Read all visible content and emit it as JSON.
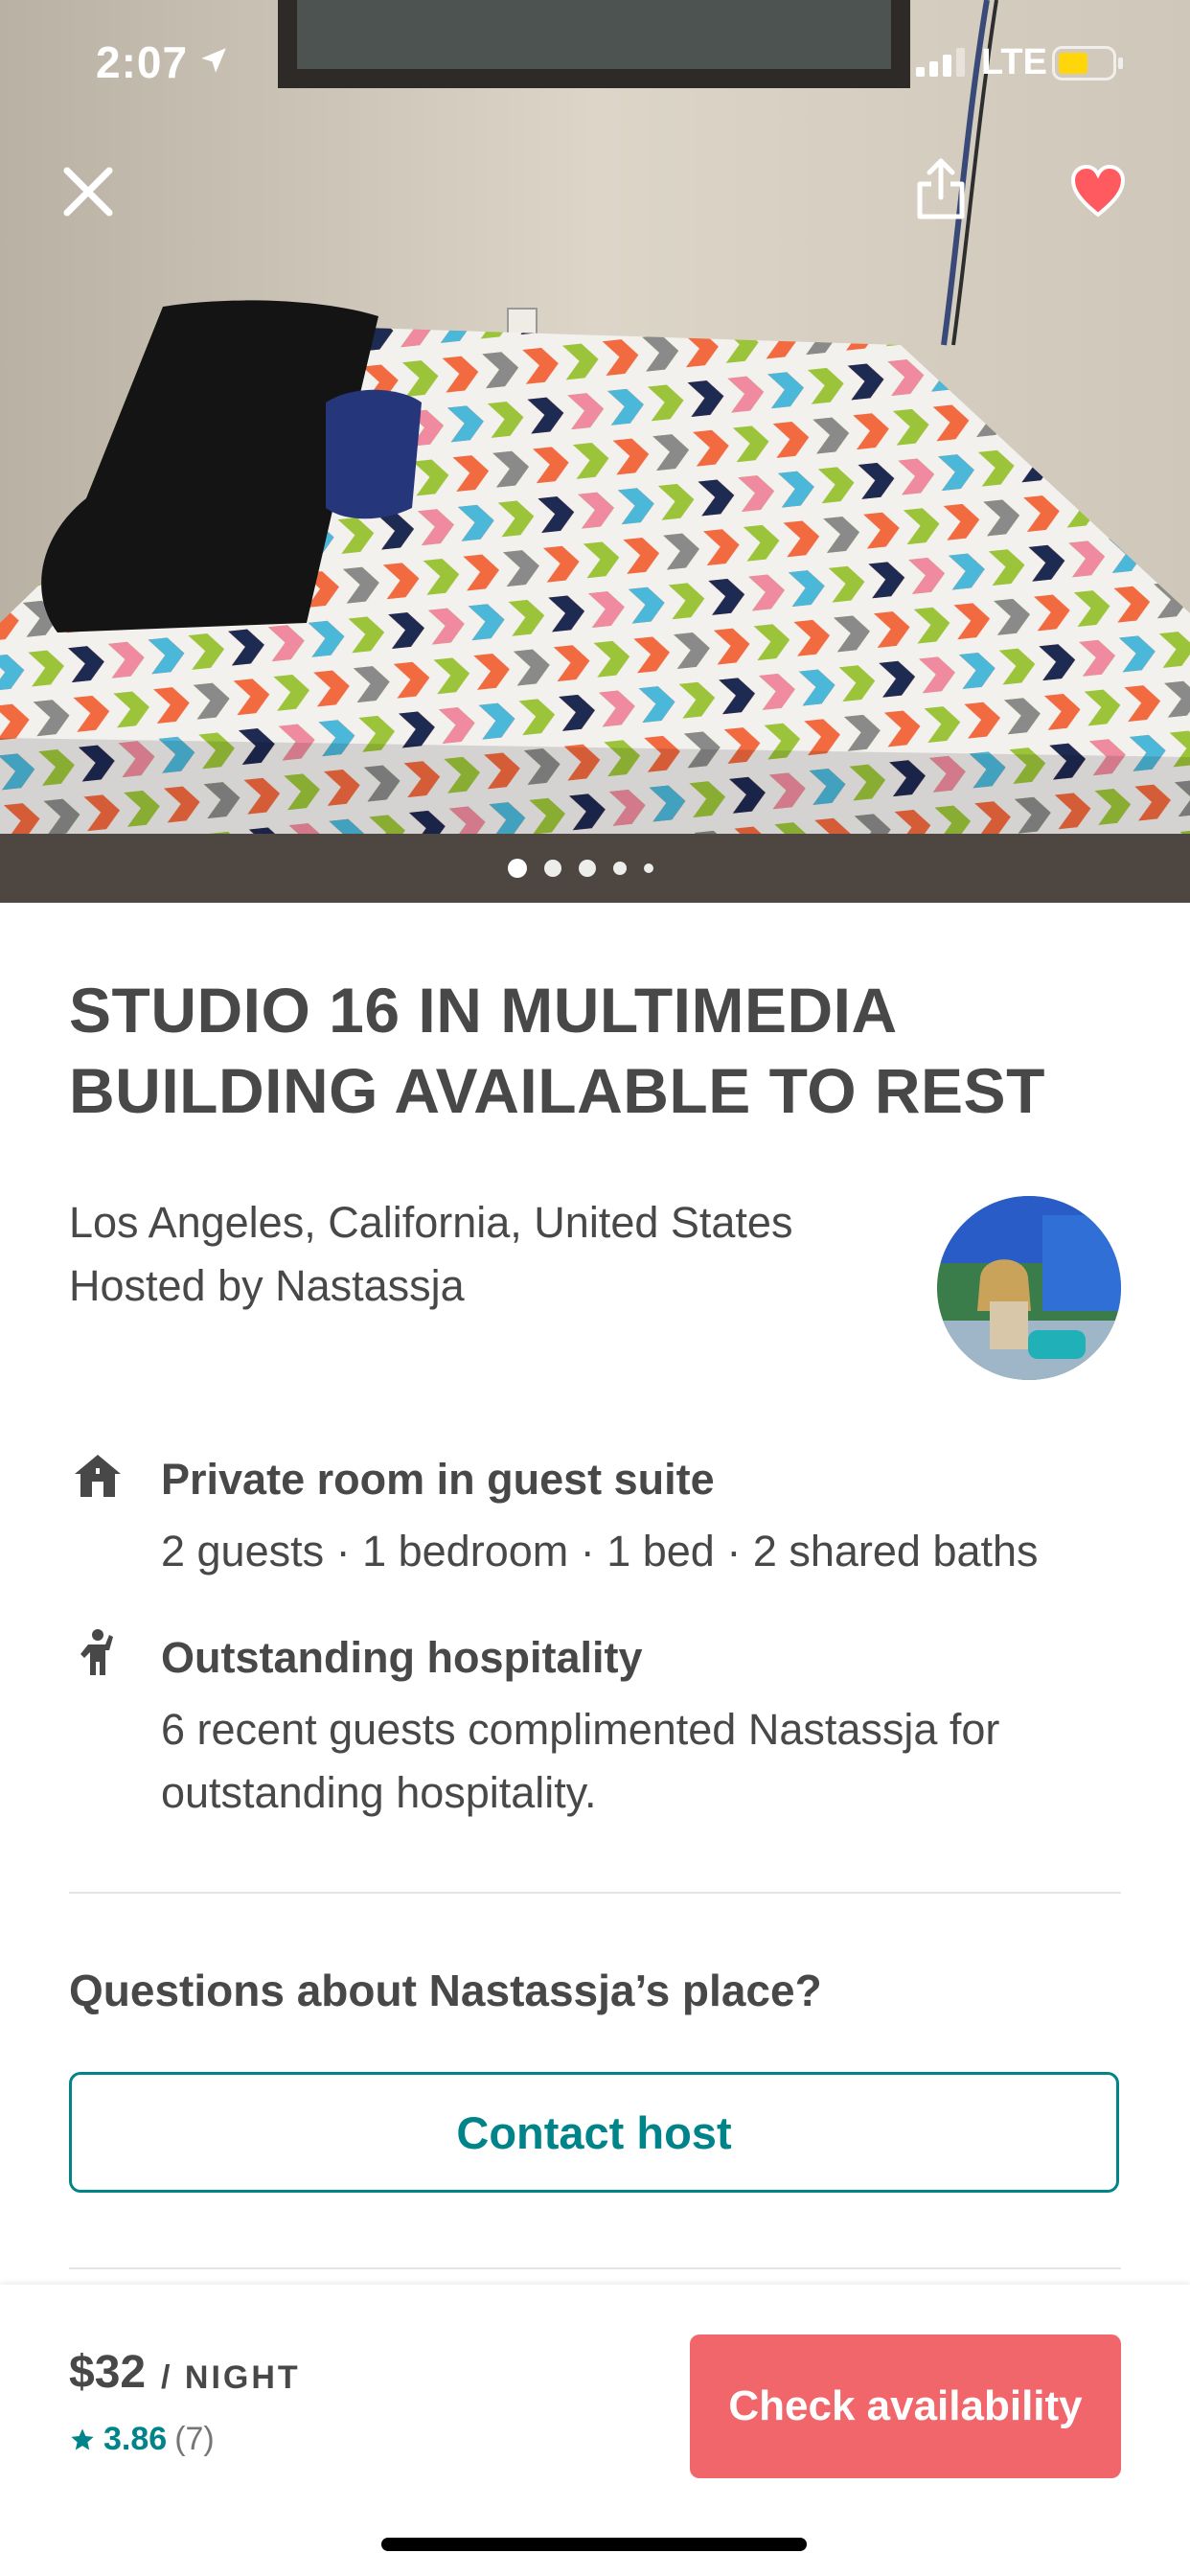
{
  "status_bar": {
    "time": "2:07",
    "network": "LTE"
  },
  "listing": {
    "title_line1": "STUDIO 16 IN MULTIMEDIA",
    "title_line2": "BUILDING AVAILABLE TO REST",
    "location": "Los Angeles, California, United States",
    "hosted_by": "Hosted by Nastassja",
    "photo_count": 5,
    "active_photo_index": 0
  },
  "features": [
    {
      "icon": "house-icon",
      "title": "Private room in guest suite",
      "subtitle": "2 guests · 1 bedroom · 1 bed · 2 shared baths"
    },
    {
      "icon": "hospitality-icon",
      "title": "Outstanding hospitality",
      "subtitle_line1": "6 recent guests complimented Nastassja for",
      "subtitle_line2": "outstanding hospitality."
    }
  ],
  "contact": {
    "question": "Questions about Nastassja’s place?",
    "button_label": "Contact host"
  },
  "footer": {
    "price": "$32",
    "per": "/ NIGHT",
    "rating_value": "3.86",
    "rating_count": "(7)",
    "check_button_label": "Check availability"
  },
  "colors": {
    "accent_teal": "#008489",
    "cta_coral": "#f0666a",
    "heart_red": "#ff5a5f",
    "text": "#484848"
  }
}
